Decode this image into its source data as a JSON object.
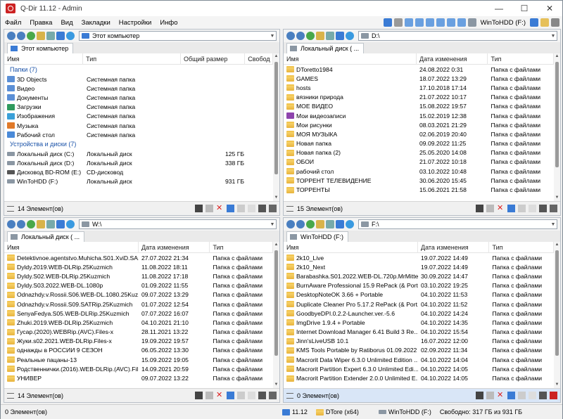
{
  "window": {
    "title": "Q-Dir 11.12 - Admin",
    "minimize": "—",
    "maximize": "☐",
    "close": "✕"
  },
  "menu": [
    "Файл",
    "Правка",
    "Вид",
    "Закладки",
    "Настройки",
    "Инфо"
  ],
  "toolbar_right": {
    "drive_label": "WinToHDD (F:)"
  },
  "panes": [
    {
      "address": "Этот компьютер",
      "tab": "Этот компьютер",
      "columns": [
        "Имя",
        "Тип",
        "Общий размер",
        "Свобод"
      ],
      "groups": [
        {
          "title": "Папки (7)",
          "rows": [
            {
              "name": "3D Objects",
              "type": "Системная папка",
              "size": "",
              "free": ""
            },
            {
              "name": "Видео",
              "type": "Системная папка",
              "size": "",
              "free": ""
            },
            {
              "name": "Документы",
              "type": "Системная папка",
              "size": "",
              "free": ""
            },
            {
              "name": "Загрузки",
              "type": "Системная папка",
              "size": "",
              "free": ""
            },
            {
              "name": "Изображения",
              "type": "Системная папка",
              "size": "",
              "free": ""
            },
            {
              "name": "Музыка",
              "type": "Системная папка",
              "size": "",
              "free": ""
            },
            {
              "name": "Рабочий стол",
              "type": "Системная папка",
              "size": "",
              "free": ""
            }
          ]
        },
        {
          "title": "Устройства и диски (7)",
          "rows": [
            {
              "name": "Локальный диск (C:)",
              "type": "Локальный диск",
              "size": "125 ГБ",
              "free": ""
            },
            {
              "name": "Локальный диск (D:)",
              "type": "Локальный диск",
              "size": "338 ГБ",
              "free": ""
            },
            {
              "name": "Дисковод BD-ROM (E:)",
              "type": "CD-дисковод",
              "size": "",
              "free": ""
            },
            {
              "name": "WinToHDD (F:)",
              "type": "Локальный диск",
              "size": "931 ГБ",
              "free": ""
            }
          ]
        }
      ],
      "status": "14 Элемент(ов)"
    },
    {
      "address": "D:\\",
      "tab": "Локальный диск ( ...",
      "columns": [
        "Имя",
        "Дата изменения",
        "Тип"
      ],
      "rows": [
        {
          "name": "DToretto1984",
          "date": "24.08.2022 0:31",
          "type": "Папка с файлами"
        },
        {
          "name": "GAMES",
          "date": "18.07.2022 13:29",
          "type": "Папка с файлами"
        },
        {
          "name": "hosts",
          "date": "17.10.2018 17:14",
          "type": "Папка с файлами"
        },
        {
          "name": "вязники природа",
          "date": "21.07.2022 10:17",
          "type": "Папка с файлами"
        },
        {
          "name": "МОЕ ВИДЕО",
          "date": "15.08.2022 19:57",
          "type": "Папка с файлами"
        },
        {
          "name": "Мои видеозаписи",
          "date": "15.02.2019 12:38",
          "type": "Папка с файлами"
        },
        {
          "name": "Мои рисунки",
          "date": "08.03.2021 21:29",
          "type": "Папка с файлами"
        },
        {
          "name": "МОЯ МУЗЫКА",
          "date": "02.06.2019 20:40",
          "type": "Папка с файлами"
        },
        {
          "name": "Новая папка",
          "date": "09.09.2022 11:25",
          "type": "Папка с файлами"
        },
        {
          "name": "Новая папка (2)",
          "date": "25.05.2020 14:08",
          "type": "Папка с файлами"
        },
        {
          "name": "ОБОИ",
          "date": "21.07.2022 10:18",
          "type": "Папка с файлами"
        },
        {
          "name": "рабочий стол",
          "date": "03.10.2022 10:48",
          "type": "Папка с файлами"
        },
        {
          "name": "ТОРРЕНТ ТЕЛЕВИДЕНИЕ",
          "date": "30.06.2020 15:45",
          "type": "Папка с файлами"
        },
        {
          "name": "ТОРРЕНТЫ",
          "date": "15.06.2021 21:58",
          "type": "Папка с файлами"
        }
      ],
      "status": "15 Элемент(ов)"
    },
    {
      "address": "W:\\",
      "tab": "Локальный диск ( ...",
      "columns": [
        "Имя",
        "Дата изменения",
        "Тип"
      ],
      "rows": [
        {
          "name": "Detektivnoe.agentstvo.Muhicha.S01.XviD.SA...",
          "date": "27.07.2022 21:34",
          "type": "Папка с файлами"
        },
        {
          "name": "Dyldy.2019.WEB-DLRip.25Kuzmich",
          "date": "11.08.2022 18:11",
          "type": "Папка с файлами"
        },
        {
          "name": "Dyldy.S02.WEB-DLRip.25Kuzmich",
          "date": "11.08.2022 17:18",
          "type": "Папка с файлами"
        },
        {
          "name": "Dyldy.S03.2022.WEB-DL.1080p",
          "date": "01.09.2022 11:55",
          "type": "Папка с файлами"
        },
        {
          "name": "Odnazhdy.v.Rossii.S06.WEB-DL.1080.25Kuz...",
          "date": "09.07.2022 13:29",
          "type": "Папка с файлами"
        },
        {
          "name": "Odnazhdy.v.Rossii.S09.SATRip.25Kuzmich",
          "date": "01.07.2022 12:54",
          "type": "Папка с файлами"
        },
        {
          "name": "SenyaFedya.S05.WEB-DLRip.25Kuzmich",
          "date": "07.07.2022 16:07",
          "type": "Папка с файлами"
        },
        {
          "name": "Zhuki.2019.WEB-DLRip.25Kuzmich",
          "date": "04.10.2021 21:10",
          "type": "Папка с файлами"
        },
        {
          "name": "Гусар.(2020).WEBRip.(AVC).Files-x",
          "date": "28.11.2021 13:22",
          "type": "Папка с файлами"
        },
        {
          "name": "Жуки.s02.2021.WEB-DLRip.Files-x",
          "date": "19.09.2022 19:57",
          "type": "Папка с файлами"
        },
        {
          "name": "однажды в РОССИИ 9 СЕЗОН",
          "date": "06.05.2022 13:30",
          "type": "Папка с файлами"
        },
        {
          "name": "Реальные пацаны-13",
          "date": "15.09.2022 19:05",
          "type": "Папка с файлами"
        },
        {
          "name": "Родственнички.(2016).WEB-DLRip.(AVC).Fil...",
          "date": "14.09.2021 20:59",
          "type": "Папка с файлами"
        },
        {
          "name": "УНИВЕР",
          "date": "09.07.2022 13:22",
          "type": "Папка с файлами"
        }
      ],
      "status": "14 Элемент(ов)"
    },
    {
      "address": "F:\\",
      "tab": "WinToHDD (F:)",
      "columns": [
        "Имя",
        "Дата изменения",
        "Тип"
      ],
      "rows": [
        {
          "name": "2k10_Live",
          "date": "19.07.2022 14:49",
          "type": "Папка с файлами"
        },
        {
          "name": "2k10_Next",
          "date": "19.07.2022 14:49",
          "type": "Папка с файлами"
        },
        {
          "name": "Barabashka.S01.2022.WEB-DL.720p.MrMittens",
          "date": "30.09.2022 14:47",
          "type": "Папка с файлами"
        },
        {
          "name": "BurnAware Professional 15.9 RePack (& Port...",
          "date": "03.10.2022 19:25",
          "type": "Папка с файлами"
        },
        {
          "name": "DesktopNoteOK 3.66 + Portable",
          "date": "04.10.2022 11:53",
          "type": "Папка с файлами"
        },
        {
          "name": "Duplicate Cleaner Pro 5.17.2 RePack (& Port...",
          "date": "04.10.2022 11:52",
          "type": "Папка с файлами"
        },
        {
          "name": "GoodbyeDPI.0.2.2-Launcher.ver.-5.6",
          "date": "04.10.2022 14:24",
          "type": "Папка с файлами"
        },
        {
          "name": "ImgDrive 1.9.4 + Portable",
          "date": "04.10.2022 14:35",
          "type": "Папка с файлами"
        },
        {
          "name": "Internet Download Manager 6.41 Build 3 Re...",
          "date": "04.10.2022 15:54",
          "type": "Папка с файлами"
        },
        {
          "name": "Jinn'sLiveUSB 10.1",
          "date": "16.07.2022 12:00",
          "type": "Папка с файлами"
        },
        {
          "name": "KMS Tools Portable by Ratiborus 01.09.2022",
          "date": "02.09.2022 11:34",
          "type": "Папка с файлами"
        },
        {
          "name": "Macrorit Data Wiper 6.3.0 Unlimited Edition ...",
          "date": "04.10.2022 14:04",
          "type": "Папка с файлами"
        },
        {
          "name": "Macrorit Partition Expert 6.3.0 Unlimited Edi...",
          "date": "04.10.2022 14:05",
          "type": "Папка с файлами"
        },
        {
          "name": "Macrorit Partition Extender 2.0.0 Unlimited E...",
          "date": "04.10.2022 14:05",
          "type": "Папка с файлами"
        }
      ],
      "status": "0 Элемент(ов)"
    }
  ],
  "bottombar": {
    "items_count": "0 Элемент(ов)",
    "version": "11.12",
    "user": "DTore (x64)",
    "drive": "WinToHDD (F:)",
    "free": "Свободно: 317 ГБ из 931 ГБ"
  },
  "colors": {
    "accent": "#1a52a8",
    "active_status": "#d9e6f7",
    "folder": "#f1c44e",
    "app_icon": "#cc2222"
  }
}
